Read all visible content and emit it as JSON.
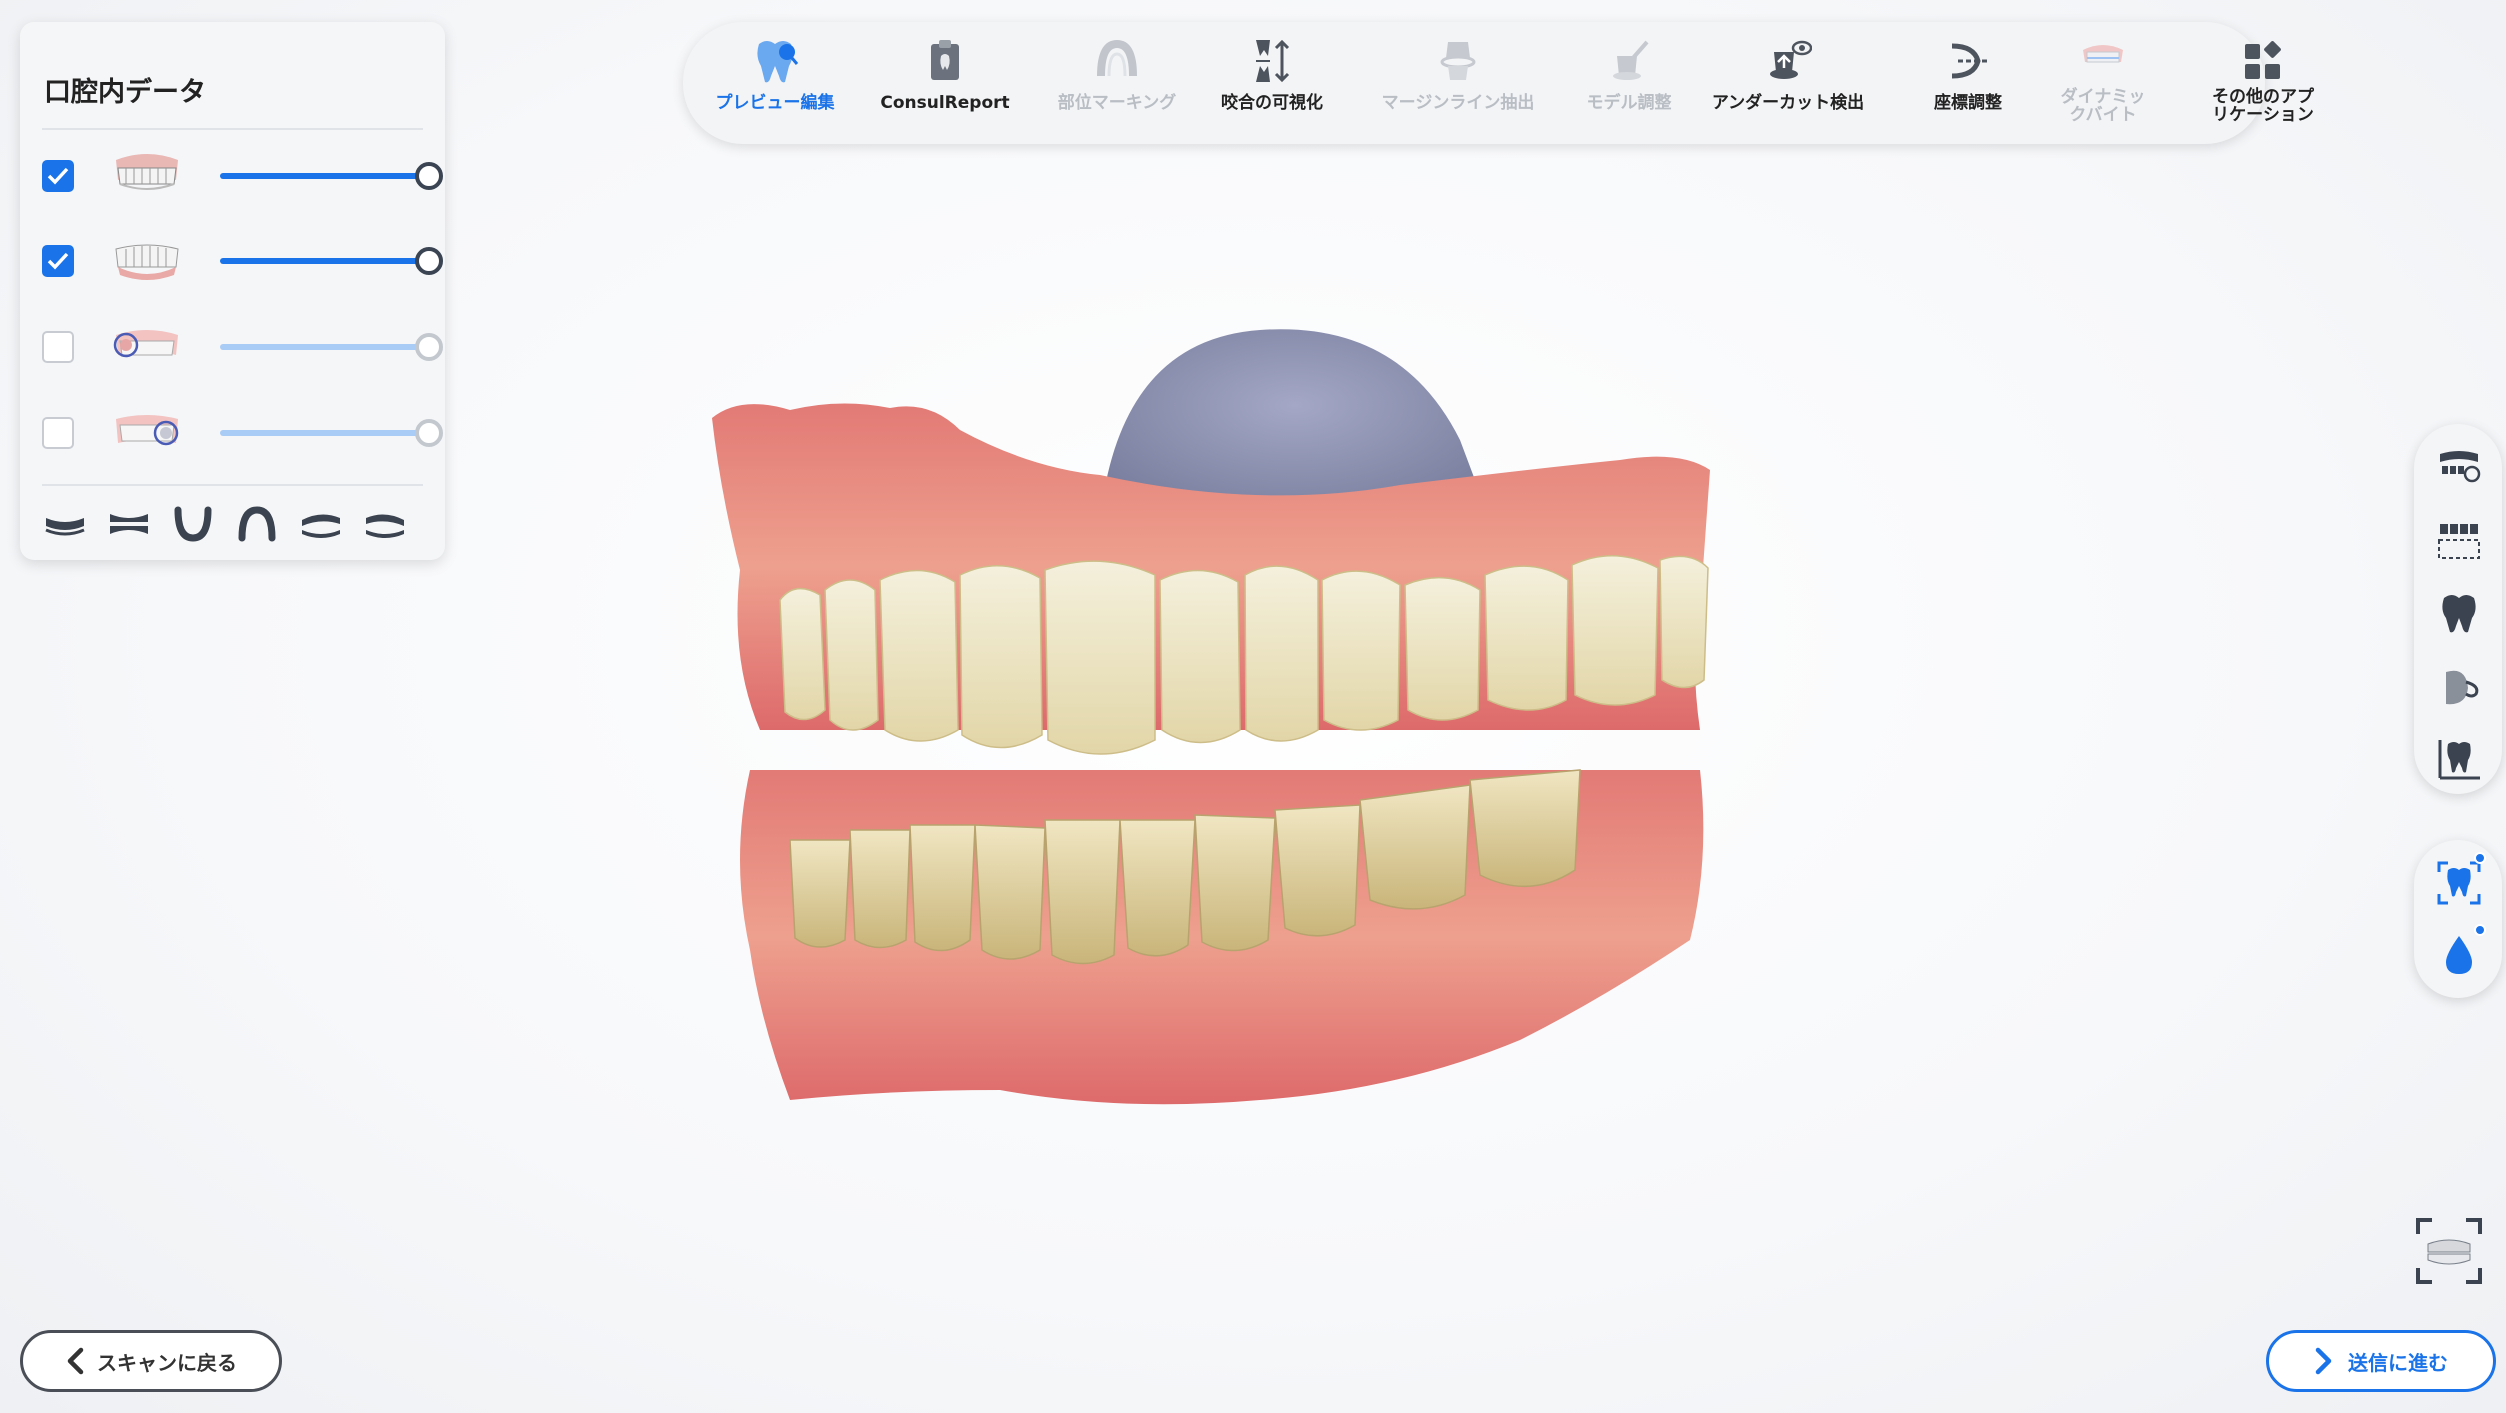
{
  "panel": {
    "title": "口腔内データ",
    "layers": [
      {
        "name": "upper-jaw",
        "checked": true,
        "opacity": 1.0
      },
      {
        "name": "lower-jaw",
        "checked": true,
        "opacity": 1.0
      },
      {
        "name": "upper-preop",
        "checked": false,
        "opacity": 1.0
      },
      {
        "name": "lower-preop",
        "checked": false,
        "opacity": 1.0
      }
    ],
    "view_icons": [
      "view-bottom-icon",
      "view-side-icon",
      "view-lower-icon",
      "view-upper-icon",
      "view-left-icon",
      "view-right-icon"
    ]
  },
  "toolbar": {
    "items": [
      {
        "label": "プレビュー編集",
        "state": "active",
        "icon": "tooth-preview-icon"
      },
      {
        "label": "ConsulReport",
        "state": "normal",
        "icon": "report-icon"
      },
      {
        "label": "部位マーキング",
        "state": "disabled",
        "icon": "arch-marking-icon"
      },
      {
        "label": "咬合の可視化",
        "state": "normal",
        "icon": "occlusion-icon"
      },
      {
        "label": "マージンライン抽出",
        "state": "disabled",
        "icon": "margin-line-icon"
      },
      {
        "label": "モデル調整",
        "state": "disabled",
        "icon": "model-adjust-icon"
      },
      {
        "label": "アンダーカット検出",
        "state": "normal",
        "icon": "undercut-icon"
      },
      {
        "label": "座標調整",
        "state": "normal",
        "icon": "coordinate-icon"
      },
      {
        "label": "ダイナミッ",
        "label2": "クバイト",
        "state": "disabled",
        "icon": "dynamic-bite-icon"
      },
      {
        "label": "その他のアプ",
        "label2": "リケーション",
        "state": "normal",
        "icon": "apps-grid-icon"
      }
    ]
  },
  "side_tools": [
    "tooth-numbering-icon",
    "tooth-grid-icon",
    "single-tooth-icon",
    "tongue-icon",
    "tooth-measure-icon"
  ],
  "side_tools_2": [
    "tooth-view-icon",
    "water-drop-icon"
  ],
  "buttons": {
    "back": "スキャンに戻る",
    "next": "送信に進む"
  },
  "colors": {
    "accent": "#1a73e8",
    "gum": "#e2736f",
    "tooth": "#f1ead0",
    "palate": "#8e93b2"
  }
}
